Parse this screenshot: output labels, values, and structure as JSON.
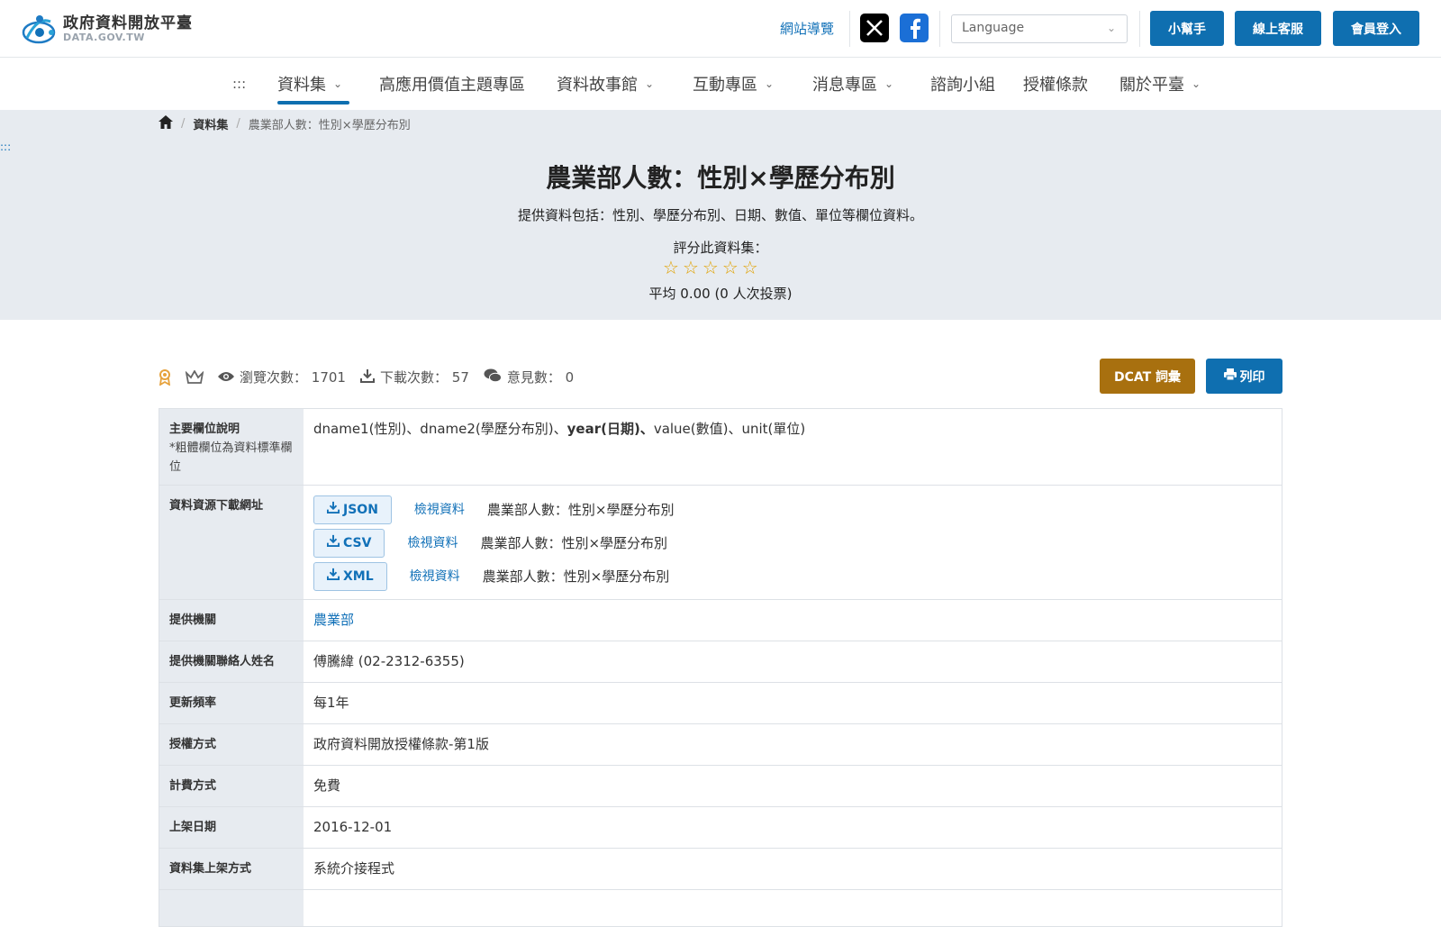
{
  "header": {
    "logo_title": "政府資料開放平臺",
    "logo_sub": "DATA.GOV.TW",
    "site_guide": "網站導覽",
    "language_placeholder": "Language",
    "helper_btn": "小幫手",
    "online_service_btn": "線上客服",
    "login_btn": "會員登入",
    "brand_color": "#0f6fb0"
  },
  "nav": {
    "skip": ":::",
    "items": [
      {
        "label": "資料集",
        "dropdown": true
      },
      {
        "label": "高應用價值主題專區",
        "dropdown": false
      },
      {
        "label": "資料故事館",
        "dropdown": true
      },
      {
        "label": "互動專區",
        "dropdown": true
      },
      {
        "label": "消息專區",
        "dropdown": true
      },
      {
        "label": "諮詢小組",
        "dropdown": false
      },
      {
        "label": "授權條款",
        "dropdown": false
      },
      {
        "label": "關於平臺",
        "dropdown": true
      }
    ],
    "active_index": 0
  },
  "breadcrumb": {
    "level1": "資料集",
    "level2": "農業部人數：性別×學歷分布別"
  },
  "hero": {
    "skip": ":::",
    "title": "農業部人數：性別×學歷分布別",
    "description": "提供資料包括：性別、學歷分布別、日期、數值、單位等欄位資料。",
    "rate_label": "評分此資料集：",
    "rating_value": 0,
    "rating_max": 5,
    "average": "平均 0.00 (0 人次投票)"
  },
  "stats": {
    "views_label": "瀏覽次數：",
    "views": "1701",
    "downloads_label": "下載次數：",
    "downloads": "57",
    "comments_label": "意見數：",
    "comments": "0",
    "dcat_btn": "DCAT 詞彙",
    "print_btn": "列印"
  },
  "table": {
    "fields_label": "主要欄位說明",
    "fields_note": "*粗體欄位為資料標準欄位",
    "fields_pre": "dname1(性別)、dname2(學歷分布別)、",
    "fields_bold": "year(日期)、",
    "fields_post": "value(數值)、unit(單位)",
    "download_label": "資料資源下載網址",
    "downloads": [
      {
        "format": "JSON",
        "view": "檢視資料",
        "name": "農業部人數：性別×學歷分布別"
      },
      {
        "format": "CSV",
        "view": "檢視資料",
        "name": "農業部人數：性別×學歷分布別"
      },
      {
        "format": "XML",
        "view": "檢視資料",
        "name": "農業部人數：性別×學歷分布別"
      }
    ],
    "provider_label": "提供機關",
    "provider": "農業部",
    "contact_label": "提供機關聯絡人姓名",
    "contact": "傅騰緯 (02-2312-6355)",
    "frequency_label": "更新頻率",
    "frequency": "每1年",
    "license_label": "授權方式",
    "license": "政府資料開放授權條款-第1版",
    "fee_label": "計費方式",
    "fee": "免費",
    "publish_label": "上架日期",
    "publish": "2016-12-01",
    "method_label": "資料集上架方式",
    "method": "系統介接程式"
  }
}
